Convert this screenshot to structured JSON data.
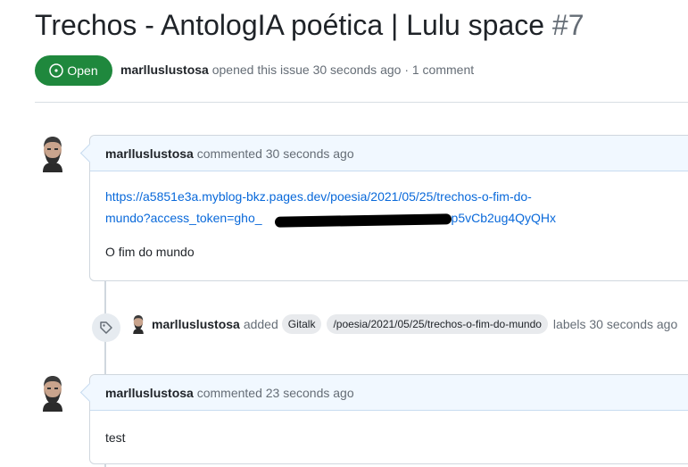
{
  "issue": {
    "title": "Trechos - AntologIA poética | Lulu space",
    "number": "#7",
    "state_label": "Open",
    "author": "marlluslustosa",
    "meta_text": "opened this issue 30 seconds ago · 1 comment"
  },
  "comments": [
    {
      "author": "marlluslustosa",
      "action": "commented 30 seconds ago",
      "link_line1": "https://a5851e3a.myblog-bkz.pages.dev/poesia/2021/05/25/trechos-o-fim-do-",
      "link_line2_start": "mundo?access_token=gho_",
      "link_line2_end": "p5vCb2ug4QyQHx",
      "text": "O fim do mundo"
    },
    {
      "author": "marlluslustosa",
      "action": "commented 23 seconds ago",
      "text": "test"
    }
  ],
  "event": {
    "author": "marlluslustosa",
    "verb": "added",
    "labels": [
      "Gitalk",
      "/poesia/2021/05/25/trechos-o-fim-do-mundo"
    ],
    "suffix": "labels 30 seconds ago"
  },
  "colors": {
    "open_green": "#1f883d",
    "link_blue": "#0969da",
    "header_blue": "#f1f8ff"
  },
  "icons": [
    "issue-opened-icon",
    "tag-icon",
    "avatar"
  ]
}
